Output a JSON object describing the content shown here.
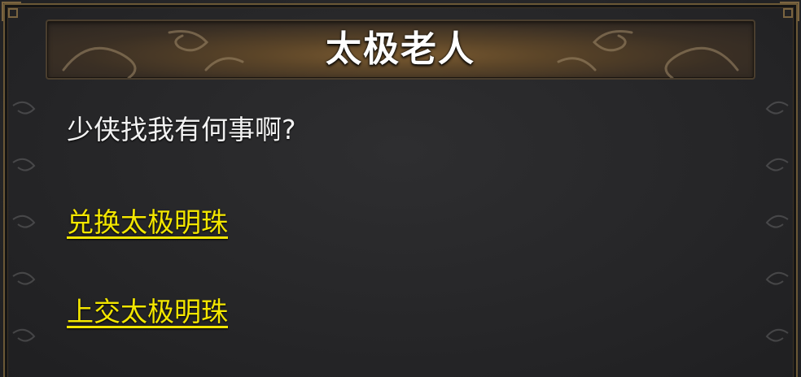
{
  "dialog": {
    "title": "太极老人",
    "prompt": "少侠找我有何事啊?",
    "options": [
      {
        "label": "兑换太极明珠"
      },
      {
        "label": "上交太极明珠"
      }
    ]
  },
  "colors": {
    "background": "#262628",
    "frame_gold": "#7a6440",
    "title_text": "#ffffff",
    "prompt_text": "#f2f2f2",
    "link_yellow": "#f3e600"
  },
  "icons": {
    "title_ornament": "cloud-scroll-ornament",
    "side_pattern": "cloud-pattern"
  }
}
